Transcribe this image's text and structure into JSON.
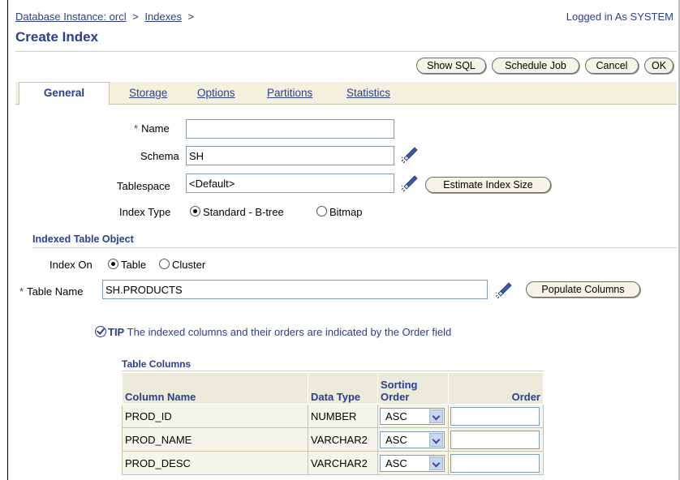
{
  "breadcrumb": {
    "instance": "Database Instance: orcl",
    "indexes": "Indexes",
    "sep": ">"
  },
  "logged_in": "Logged in As SYSTEM",
  "page_title": "Create Index",
  "actions": {
    "show_sql": "Show SQL",
    "schedule_job": "Schedule Job",
    "cancel": "Cancel",
    "ok": "OK"
  },
  "tabs": [
    {
      "label": "General",
      "active": true
    },
    {
      "label": "Storage"
    },
    {
      "label": "Options"
    },
    {
      "label": "Partitions"
    },
    {
      "label": "Statistics"
    }
  ],
  "form": {
    "name_label": "Name",
    "name_value": "",
    "schema_label": "Schema",
    "schema_value": "SH",
    "tablespace_label": "Tablespace",
    "tablespace_value": "<Default>",
    "estimate_button": "Estimate Index Size",
    "index_type_label": "Index Type",
    "index_type_options": [
      "Standard - B-tree",
      "Bitmap"
    ],
    "index_type_selected": "Standard - B-tree"
  },
  "indexed_table": {
    "section_title": "Indexed Table Object",
    "index_on_label": "Index On",
    "index_on_options": [
      "Table",
      "Cluster"
    ],
    "index_on_selected": "Table",
    "table_name_label": "Table Name",
    "table_name_value": "SH.PRODUCTS",
    "populate_button": "Populate Columns"
  },
  "tip": {
    "label": "TIP",
    "text": "The indexed columns and their orders are indicated by the Order field"
  },
  "table_columns": {
    "title": "Table Columns",
    "headers": [
      "Column Name",
      "Data Type",
      "Sorting Order",
      "Order"
    ],
    "rows": [
      {
        "column": "PROD_ID",
        "type": "NUMBER",
        "sort": "ASC",
        "order": ""
      },
      {
        "column": "PROD_NAME",
        "type": "VARCHAR2",
        "sort": "ASC",
        "order": ""
      },
      {
        "column": "PROD_DESC",
        "type": "VARCHAR2",
        "sort": "ASC",
        "order": ""
      }
    ]
  },
  "colors": {
    "link": "#2b3f8c",
    "tab_bar": "#f3f1de",
    "header_bg": "#ebeadb"
  }
}
